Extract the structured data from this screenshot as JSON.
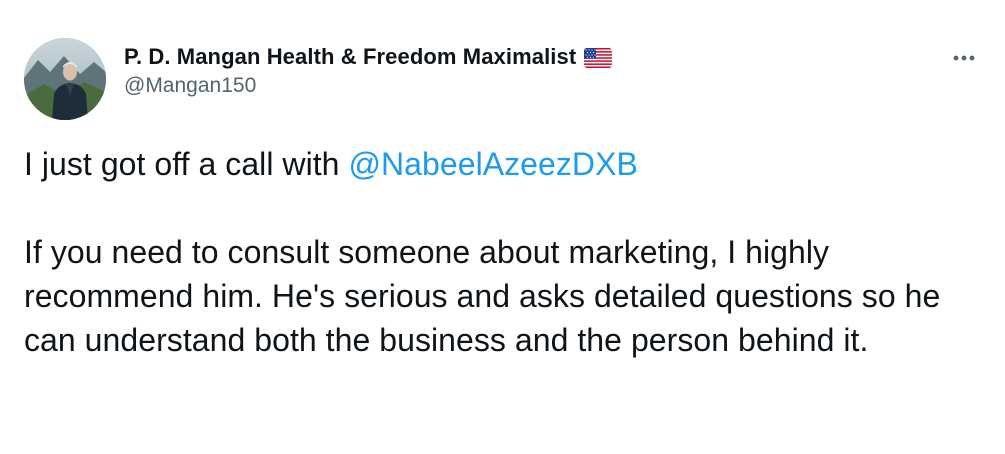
{
  "tweet": {
    "author": {
      "display_name": "P. D. Mangan Health & Freedom Maximalist",
      "handle": "@Mangan150",
      "flag_icon": "us-flag-icon"
    },
    "more_icon": "more-horizontal-icon",
    "body": {
      "line1_prefix": "I just got off a call with ",
      "mention": "@NabeelAzeezDXB",
      "paragraph2": "If you need to consult someone about marketing, I highly recommend him. He's serious and asks detailed questions so he can understand both the business and the person behind it."
    },
    "colors": {
      "text": "#0f1419",
      "secondary": "#536471",
      "link": "#1d9bf0"
    }
  }
}
